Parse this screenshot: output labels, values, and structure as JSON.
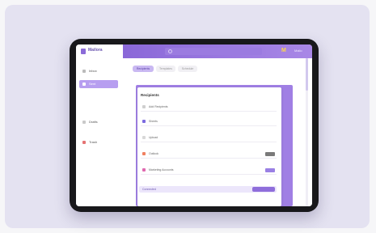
{
  "app": {
    "brand_name": "Mailora",
    "accent_color": "#8b6bd8",
    "user_label": "Mailo"
  },
  "sidebar": {
    "items": [
      {
        "label": "Inbox",
        "icon": "mail-icon",
        "active": false
      },
      {
        "label": "Sent",
        "icon": "send-icon",
        "active": true
      },
      {
        "label": "Drafts",
        "icon": "draft-icon",
        "active": false
      },
      {
        "label": "Trash",
        "icon": "trash-icon",
        "active": false
      }
    ]
  },
  "main": {
    "tabs": [
      {
        "label": "Recipients",
        "active": true
      },
      {
        "label": "Templates",
        "active": false
      },
      {
        "label": "Schedule",
        "active": false
      }
    ],
    "panel": {
      "title": "Recipients",
      "rows": [
        {
          "label": "Add Recipients",
          "icon": "user-icon",
          "badge": false
        },
        {
          "label": "Sheets",
          "icon": "sheet-icon",
          "badge": false
        },
        {
          "label": "Upload",
          "icon": "upload-icon",
          "badge": false
        },
        {
          "label": "Outlook",
          "icon": "outlook-icon",
          "badge": true
        },
        {
          "label": "Marketing Accounts",
          "icon": "list-icon",
          "badge": true
        }
      ],
      "footer_label": "Connected"
    }
  }
}
